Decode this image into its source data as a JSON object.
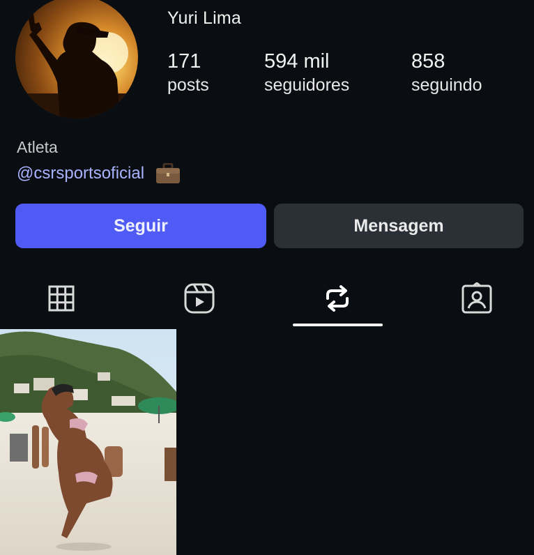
{
  "profile": {
    "name": "Yuri Lima",
    "stats": [
      {
        "value": "171",
        "label": "posts"
      },
      {
        "value": "594 mil",
        "label": "seguidores"
      },
      {
        "value": "858",
        "label": "seguindo"
      }
    ],
    "bio": {
      "category": "Atleta",
      "link": "@csrsportsoficial",
      "link_icon": "briefcase-icon"
    }
  },
  "actions": {
    "follow_label": "Seguir",
    "message_label": "Mensagem"
  },
  "tabs": [
    {
      "icon": "grid-icon"
    },
    {
      "icon": "reels-icon"
    },
    {
      "icon": "repost-icon",
      "active": true
    },
    {
      "icon": "tagged-icon"
    }
  ],
  "colors": {
    "background": "#0a0d11",
    "follow_button": "#4f5bf4",
    "message_button": "#2b2f36",
    "link": "#a9b3ff"
  }
}
